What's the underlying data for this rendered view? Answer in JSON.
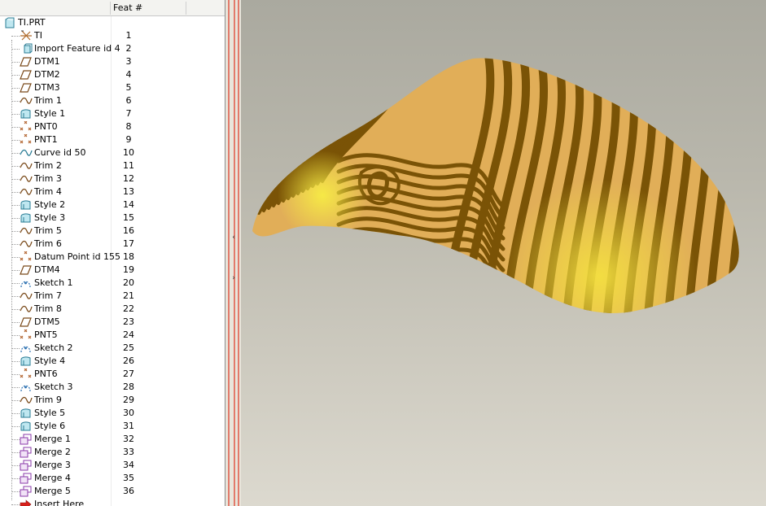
{
  "model_tree": {
    "header": {
      "name_column": "",
      "feat_column": "Feat #"
    },
    "root": {
      "label": "TI.PRT",
      "icon": "part-icon"
    },
    "items": [
      {
        "label": "TI",
        "feat": "1",
        "icon": "csys-icon"
      },
      {
        "label": "Import Feature id 4",
        "feat": "2",
        "icon": "import-feature-icon"
      },
      {
        "label": "DTM1",
        "feat": "3",
        "icon": "datum-plane-icon"
      },
      {
        "label": "DTM2",
        "feat": "4",
        "icon": "datum-plane-icon"
      },
      {
        "label": "DTM3",
        "feat": "5",
        "icon": "datum-plane-icon"
      },
      {
        "label": "Trim 1",
        "feat": "6",
        "icon": "trim-icon"
      },
      {
        "label": "Style 1",
        "feat": "7",
        "icon": "style-icon"
      },
      {
        "label": "PNT0",
        "feat": "8",
        "icon": "datum-point-icon"
      },
      {
        "label": "PNT1",
        "feat": "9",
        "icon": "datum-point-icon"
      },
      {
        "label": "Curve id 50",
        "feat": "10",
        "icon": "curve-icon"
      },
      {
        "label": "Trim 2",
        "feat": "11",
        "icon": "trim-icon"
      },
      {
        "label": "Trim 3",
        "feat": "12",
        "icon": "trim-icon"
      },
      {
        "label": "Trim 4",
        "feat": "13",
        "icon": "trim-icon"
      },
      {
        "label": "Style 2",
        "feat": "14",
        "icon": "style-icon"
      },
      {
        "label": "Style 3",
        "feat": "15",
        "icon": "style-icon"
      },
      {
        "label": "Trim 5",
        "feat": "16",
        "icon": "trim-icon"
      },
      {
        "label": "Trim 6",
        "feat": "17",
        "icon": "trim-icon"
      },
      {
        "label": "Datum Point id 155",
        "feat": "18",
        "icon": "datum-point-icon"
      },
      {
        "label": "DTM4",
        "feat": "19",
        "icon": "datum-plane-icon"
      },
      {
        "label": "Sketch 1",
        "feat": "20",
        "icon": "sketch-icon"
      },
      {
        "label": "Trim 7",
        "feat": "21",
        "icon": "trim-icon"
      },
      {
        "label": "Trim 8",
        "feat": "22",
        "icon": "trim-icon"
      },
      {
        "label": "DTM5",
        "feat": "23",
        "icon": "datum-plane-icon"
      },
      {
        "label": "PNT5",
        "feat": "24",
        "icon": "datum-point-icon"
      },
      {
        "label": "Sketch 2",
        "feat": "25",
        "icon": "sketch-icon"
      },
      {
        "label": "Style 4",
        "feat": "26",
        "icon": "style-icon"
      },
      {
        "label": "PNT6",
        "feat": "27",
        "icon": "datum-point-icon"
      },
      {
        "label": "Sketch 3",
        "feat": "28",
        "icon": "sketch-icon"
      },
      {
        "label": "Trim 9",
        "feat": "29",
        "icon": "trim-icon"
      },
      {
        "label": "Style 5",
        "feat": "30",
        "icon": "style-icon"
      },
      {
        "label": "Style 6",
        "feat": "31",
        "icon": "style-icon"
      },
      {
        "label": "Merge 1",
        "feat": "32",
        "icon": "merge-icon"
      },
      {
        "label": "Merge 2",
        "feat": "33",
        "icon": "merge-icon"
      },
      {
        "label": "Merge 3",
        "feat": "34",
        "icon": "merge-icon"
      },
      {
        "label": "Merge 4",
        "feat": "35",
        "icon": "merge-icon"
      },
      {
        "label": "Merge 5",
        "feat": "36",
        "icon": "merge-icon"
      },
      {
        "label": "Insert Here",
        "feat": "",
        "icon": "insert-here-arrow-icon"
      }
    ]
  },
  "splitter": {
    "collapse_glyph": "‹",
    "expand_glyph": "›"
  },
  "viewport": {
    "model": "zebra-striped-surface",
    "colors": {
      "light": "#e1ae58",
      "stripe": "#7a5306",
      "highlight": "#f4e040",
      "background_top": "#aaa99f",
      "background_bottom": "#dcd9cf"
    }
  }
}
